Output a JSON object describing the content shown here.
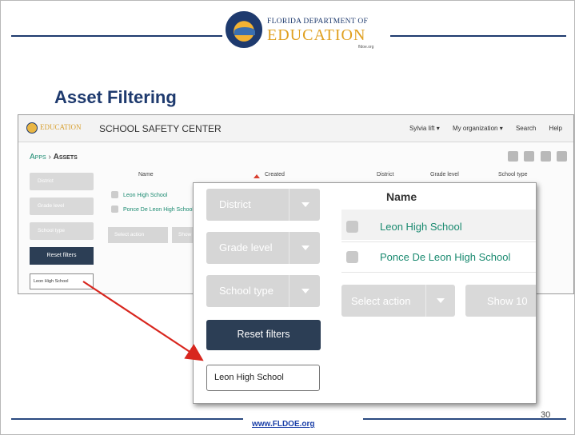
{
  "logo": {
    "line1": "FLORIDA DEPARTMENT OF",
    "line2": "EDUCATION",
    "url": "fldoe.org"
  },
  "slide": {
    "title": "Asset Filtering",
    "footer_url": "www.FLDOE.org",
    "page_number": "30"
  },
  "app": {
    "logo_text": "EDUCATION",
    "name": "SCHOOL SAFETY CENTER",
    "nav": [
      "Sylvia lift ▾",
      "My organization ▾",
      "Search",
      "Help"
    ],
    "breadcrumb": {
      "apps": "Apps",
      "sep": "›",
      "current": "Assets"
    },
    "filters": [
      "District",
      "Grade level",
      "School type"
    ],
    "reset_label": "Reset filters",
    "active_tag": "Leon High School",
    "columns": [
      "Name",
      "Created",
      "District",
      "Grade level",
      "School type"
    ],
    "rows": [
      "Leon High School",
      "Ponce De Leon High School"
    ],
    "select_action": "Select action",
    "show_label": "Show 10"
  },
  "zoom": {
    "filters": [
      "District",
      "Grade level",
      "School type"
    ],
    "reset_label": "Reset filters",
    "active_tag": "Leon High School",
    "name_header": "Name",
    "rows": [
      "Leon High School",
      "Ponce De Leon High School"
    ],
    "select_action": "Select action",
    "show_label": "Show 10"
  },
  "colors": {
    "brand_navy": "#1e3a6e",
    "link_green": "#1a8a70",
    "button_dark": "#2c3e55",
    "arrow_red": "#d8261e"
  }
}
